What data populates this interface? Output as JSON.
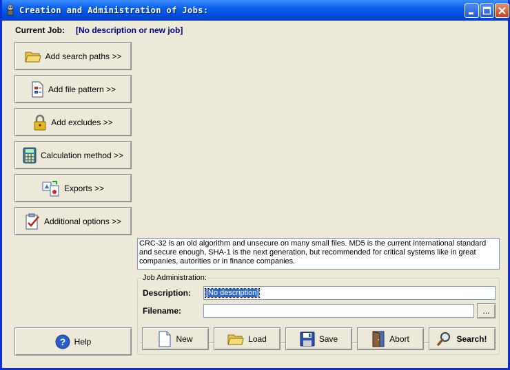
{
  "window": {
    "title": "Creation and Administration of Jobs:"
  },
  "current_job": {
    "label": "Current Job:",
    "value": "[No description or new job]"
  },
  "side_buttons": [
    {
      "label": "Add search paths >>",
      "icon": "folder-icon"
    },
    {
      "label": "Add file pattern >>",
      "icon": "file-pattern-icon"
    },
    {
      "label": "Add excludes >>",
      "icon": "lock-icon"
    },
    {
      "label": "Calculation method >>",
      "icon": "calculator-icon"
    },
    {
      "label": "Exports >>",
      "icon": "exports-icon"
    },
    {
      "label": "Additional options >>",
      "icon": "checklist-icon"
    }
  ],
  "help_button": {
    "label": "Help",
    "icon": "help-icon"
  },
  "info_text": "CRC-32 is an old algorithm and unsecure on many small files. MD5 is the current international standard and secure enough, SHA-1 is the next generation, but recommended for critical systems like in great companies, autorities or in finance companies.",
  "job_admin": {
    "group_title": "Job Administration:",
    "description_label": "Description:",
    "description_value": "[No description]",
    "filename_label": "Filename:",
    "filename_value": "",
    "browse_label": "..."
  },
  "bottom_buttons": [
    {
      "label": "New",
      "icon": "new-document-icon"
    },
    {
      "label": "Load",
      "icon": "open-folder-icon"
    },
    {
      "label": "Save",
      "icon": "floppy-disk-icon"
    },
    {
      "label": "Abort",
      "icon": "door-icon"
    },
    {
      "label": "Search!",
      "icon": "magnifier-icon"
    }
  ],
  "colors": {
    "titlebar": "#0a5fe8",
    "window_bg": "#ece9d8",
    "job_value": "#000080",
    "selection": "#316ac5"
  }
}
